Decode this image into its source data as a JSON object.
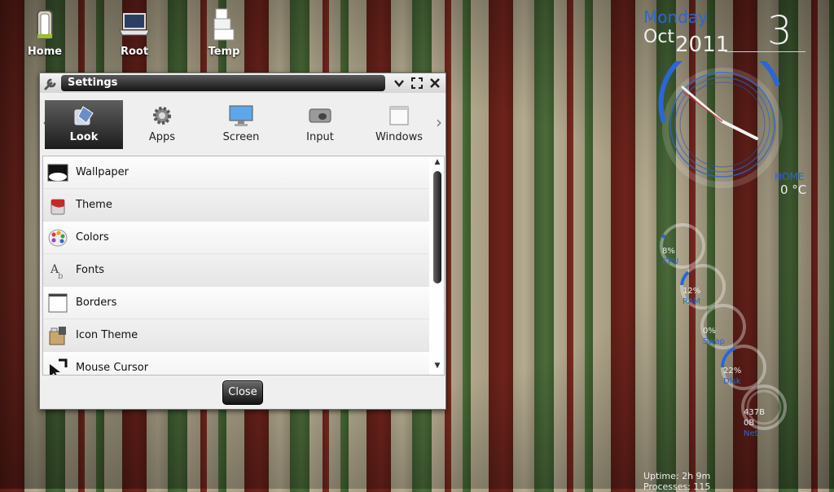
{
  "desktop": {
    "icons": [
      {
        "label": "Home",
        "icon": "trash-can-icon"
      },
      {
        "label": "Root",
        "icon": "laptop-icon"
      },
      {
        "label": "Temp",
        "icon": "boxes-icon"
      }
    ]
  },
  "window": {
    "title": "Settings",
    "categories": [
      {
        "label": "Look",
        "icon": "paint-bucket-icon",
        "active": true
      },
      {
        "label": "Apps",
        "icon": "gear-icon",
        "active": false
      },
      {
        "label": "Screen",
        "icon": "monitor-icon",
        "active": false
      },
      {
        "label": "Input",
        "icon": "mouse-icon",
        "active": false
      },
      {
        "label": "Windows",
        "icon": "window-icon",
        "active": false
      }
    ],
    "items": [
      {
        "label": "Wallpaper",
        "icon": "wallpaper-icon"
      },
      {
        "label": "Theme",
        "icon": "paint-can-icon"
      },
      {
        "label": "Colors",
        "icon": "palette-icon"
      },
      {
        "label": "Fonts",
        "icon": "fonts-icon"
      },
      {
        "label": "Borders",
        "icon": "border-icon"
      },
      {
        "label": "Icon Theme",
        "icon": "icon-theme-icon"
      },
      {
        "label": "Mouse Cursor",
        "icon": "cursor-icon"
      }
    ],
    "close_label": "Close"
  },
  "widgets": {
    "day": "Monday",
    "month": "Oct",
    "year": "2011",
    "date": "3",
    "weather_city": "HOME",
    "weather_temp": "0 °C",
    "gauges": [
      {
        "value": "8%",
        "label": "CPU",
        "percent": 8
      },
      {
        "value": "12%",
        "label": "RAM",
        "percent": 12
      },
      {
        "value": "0%",
        "label": "Swap",
        "percent": 0
      },
      {
        "value": "22%",
        "label": "Disk",
        "percent": 22
      },
      {
        "value": "437B",
        "value2": "0B",
        "label": "Net",
        "percent": 0
      }
    ],
    "uptime": "Uptime: 2h 9m",
    "processes": "Processes: 115"
  },
  "colors": {
    "accent": "#2a66d6"
  }
}
